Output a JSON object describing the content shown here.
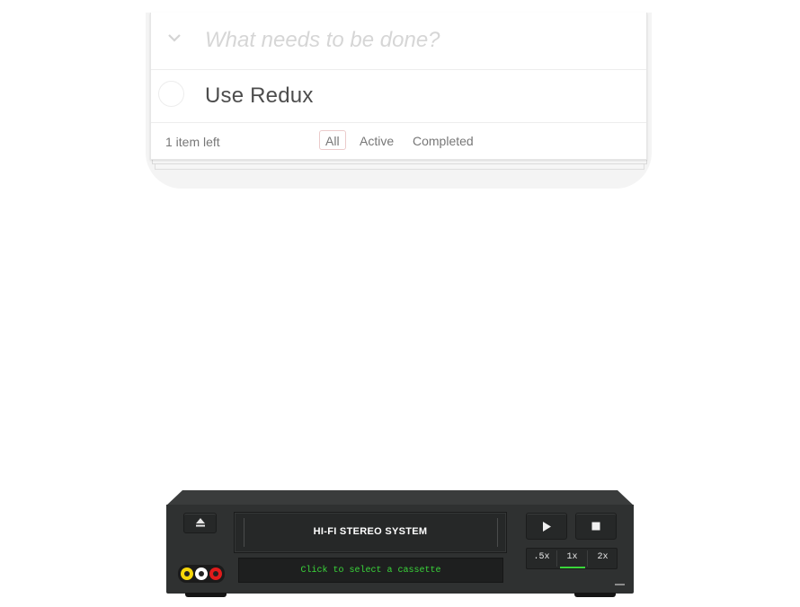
{
  "todo": {
    "input_placeholder": "What needs to be done?",
    "toggle_all_icon": "chevron-down-icon",
    "items": [
      {
        "label": "Use Redux",
        "completed": false
      }
    ],
    "footer": {
      "items_left": "1 item left",
      "filters": [
        {
          "label": "All",
          "selected": true
        },
        {
          "label": "Active",
          "selected": false
        },
        {
          "label": "Completed",
          "selected": false
        }
      ]
    }
  },
  "vcr": {
    "brand": "HI-FI STEREO SYSTEM",
    "display_text": "Click to select a cassette",
    "eject_icon": "eject-icon",
    "play_icon": "play-icon",
    "stop_icon": "stop-icon",
    "speeds": [
      ".5x",
      "1x",
      "2x"
    ],
    "selected_speed": "1x",
    "colors": {
      "body": "#2f3131",
      "display_text": "#3ad63a",
      "speed_indicator": "#3ad63a",
      "jack_yellow": "#f5d60a",
      "jack_white": "#ffffff",
      "jack_red": "#e11b1b"
    }
  },
  "colors": {
    "filter_selected_border": "rgba(175,47,47,0.25)",
    "todo_text": "#4d4d4d",
    "placeholder": "#d6d6d6"
  }
}
